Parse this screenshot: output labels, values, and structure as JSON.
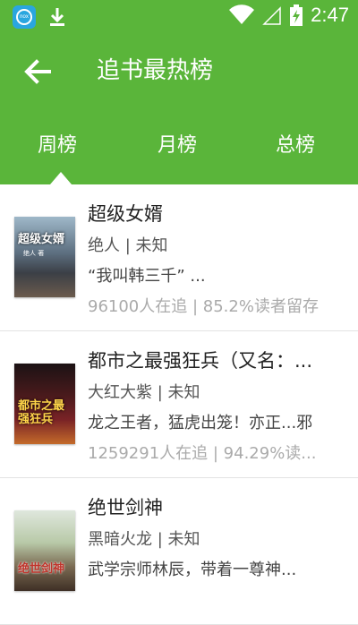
{
  "status_bar": {
    "time": "2:47",
    "icons": [
      "nox-app-icon",
      "download-icon",
      "wifi-icon",
      "cell-signal-icon",
      "battery-charging-icon"
    ],
    "nox_label": "nox"
  },
  "app_bar": {
    "title": "追书最热榜",
    "back_icon": "arrow-left-icon"
  },
  "tabs": [
    {
      "label": "周榜",
      "selected": true
    },
    {
      "label": "月榜",
      "selected": false
    },
    {
      "label": "总榜",
      "selected": false
    }
  ],
  "books": [
    {
      "title": "超级女婿",
      "author_line": "绝人 | 未知",
      "description": "“我叫韩三千” ...",
      "stats": "96100人在追 | 85.2%读者留存",
      "cover_text": "超级女婿",
      "cover_sub": "绝人 著"
    },
    {
      "title": "都市之最强狂兵（又名：...",
      "author_line": "大红大紫 | 未知",
      "description": "龙之王者，猛虎出笼！亦正...邪",
      "stats": "1259291人在追 | 94.29%读...",
      "cover_text": "都市之最强狂兵",
      "cover_sub": ""
    },
    {
      "title": "绝世剑神",
      "author_line": "黑暗火龙 | 未知",
      "description": "武学宗师林辰，带着一尊神...",
      "stats": "",
      "cover_text": "绝世剑神",
      "cover_sub": ""
    }
  ],
  "colors": {
    "primary": "#5ab53a",
    "title_text": "#222222",
    "muted_text": "#aaaaaa",
    "divider": "#e2e2e2"
  }
}
